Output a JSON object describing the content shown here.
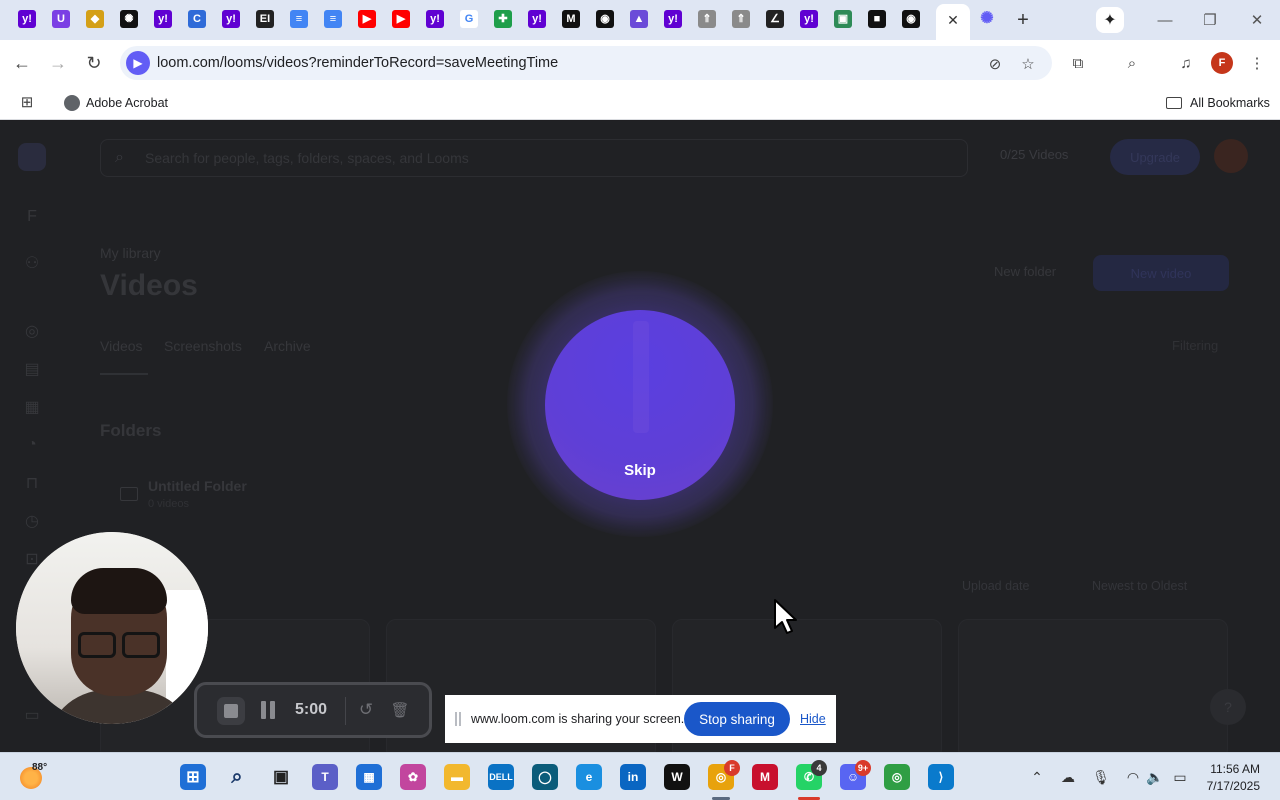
{
  "browser": {
    "tabs": [
      {
        "icon": "yahoo-icon",
        "glyph": "y!",
        "color": "#6001d2"
      },
      {
        "icon": "uphold-icon",
        "glyph": "U",
        "color": "#7b3fe4"
      },
      {
        "icon": "gold-diamond-icon",
        "glyph": "◆",
        "color": "#d4a017"
      },
      {
        "icon": "openai-icon",
        "glyph": "✺",
        "color": "#111111"
      },
      {
        "icon": "yahoo-icon",
        "glyph": "y!",
        "color": "#6001d2"
      },
      {
        "icon": "c-app-icon",
        "glyph": "C",
        "color": "#2f6bd8"
      },
      {
        "icon": "yahoo-icon",
        "glyph": "y!",
        "color": "#6001d2"
      },
      {
        "icon": "ei-app-icon",
        "glyph": "EI",
        "color": "#222222"
      },
      {
        "icon": "google-docs-icon",
        "glyph": "≡",
        "color": "#4285f4"
      },
      {
        "icon": "google-docs-icon",
        "glyph": "≡",
        "color": "#4285f4"
      },
      {
        "icon": "youtube-icon",
        "glyph": "▶",
        "color": "#ff0000"
      },
      {
        "icon": "youtube-icon",
        "glyph": "▶",
        "color": "#ff0000"
      },
      {
        "icon": "yahoo-icon",
        "glyph": "y!",
        "color": "#6001d2"
      },
      {
        "icon": "google-icon",
        "glyph": "G",
        "color": "#ffffff"
      },
      {
        "icon": "green-plus-icon",
        "glyph": "✚",
        "color": "#1e9e4a"
      },
      {
        "icon": "yahoo-icon",
        "glyph": "y!",
        "color": "#6001d2"
      },
      {
        "icon": "medium-icon",
        "glyph": "M",
        "color": "#111111"
      },
      {
        "icon": "github-icon",
        "glyph": "◉",
        "color": "#111111"
      },
      {
        "icon": "triangle-app-icon",
        "glyph": "▲",
        "color": "#6b4bd8"
      },
      {
        "icon": "yahoo-icon",
        "glyph": "y!",
        "color": "#6001d2"
      },
      {
        "icon": "rocket-icon",
        "glyph": "⇑",
        "color": "#8a8a8a"
      },
      {
        "icon": "rocket-icon",
        "glyph": "⇑",
        "color": "#8a8a8a"
      },
      {
        "icon": "feather-icon",
        "glyph": "∠",
        "color": "#222222"
      },
      {
        "icon": "yahoo-icon",
        "glyph": "y!",
        "color": "#6001d2"
      },
      {
        "icon": "chat-app-icon",
        "glyph": "▣",
        "color": "#2e8b57"
      },
      {
        "icon": "record-app-icon",
        "glyph": "■",
        "color": "#111111"
      },
      {
        "icon": "github-icon",
        "glyph": "◉",
        "color": "#111111"
      }
    ],
    "active_tab_icon": "loom-icon",
    "url": "loom.com/looms/videos?reminderToRecord=saveMeetingTime",
    "profile_initial": "F",
    "bookmarks": [
      {
        "label": "Adobe Acrobat",
        "icon": "globe-icon"
      }
    ],
    "all_bookmarks": "All Bookmarks"
  },
  "loom": {
    "search_placeholder": "Search for people, tags, folders, spaces, and Looms",
    "videos_count": "0/25 Videos",
    "upgrade_label": "Upgrade",
    "breadcrumb": "My library",
    "page_title": "Videos",
    "new_folder": "New folder",
    "new_video": "New video",
    "tabs": [
      "Videos",
      "Screenshots",
      "Archive"
    ],
    "filter_label": "Filtering",
    "folders_heading": "Folders",
    "folder_name": "Untitled Folder",
    "folder_sub": "0 videos",
    "sort_by": "Upload date",
    "sort_order": "Newest to Oldest"
  },
  "recorder": {
    "skip_label": "Skip",
    "timer": "5:00",
    "accent_color": "#5f3fd6"
  },
  "screen_share": {
    "message": "www.loom.com is sharing your screen.",
    "stop_label": "Stop sharing",
    "hide_label": "Hide"
  },
  "taskbar": {
    "weather_temp": "88°",
    "time": "11:56 AM",
    "date": "7/17/2025",
    "badges": {
      "whatsapp": "4",
      "discord": "9+",
      "chrome_profile": "F"
    }
  }
}
